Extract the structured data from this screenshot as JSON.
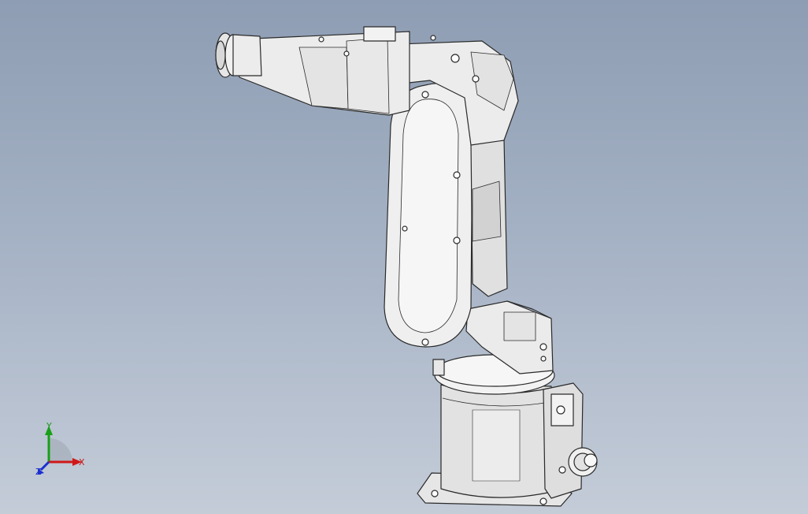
{
  "viewport": {
    "background_top": "#8e9db3",
    "background_bottom": "#c4ccd8",
    "model_fill": "#eeeeee",
    "model_shade": "#d4d4d4",
    "model_edge": "#2a2a2a"
  },
  "triad": {
    "x_label": "X",
    "y_label": "Y",
    "z_label": "Z",
    "x_color": "#d01818",
    "y_color": "#18a018",
    "z_color": "#1b2fd0"
  }
}
